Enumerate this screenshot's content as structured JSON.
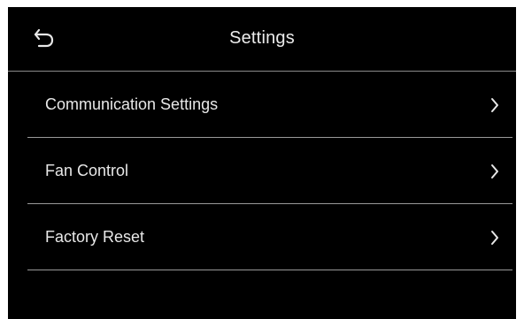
{
  "header": {
    "title": "Settings",
    "back_icon": "back-arrow-icon"
  },
  "menu": {
    "items": [
      {
        "label": "Communication Settings",
        "icon": "chevron-right-icon"
      },
      {
        "label": "Fan Control",
        "icon": "chevron-right-icon"
      },
      {
        "label": "Factory Reset",
        "icon": "chevron-right-icon"
      }
    ]
  },
  "colors": {
    "background": "#000000",
    "text": "#e8e8e8",
    "divider": "#9a9a9a"
  }
}
